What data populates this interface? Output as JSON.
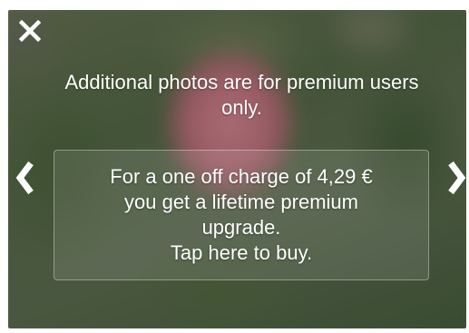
{
  "overlay": {
    "headline": "Additional photos are for premium users only.",
    "offer_lines": [
      "For a one off charge of 4,29 €",
      "you get a lifetime premium",
      "upgrade.",
      "Tap here to buy."
    ],
    "price": "4,29 €"
  },
  "controls": {
    "close_icon": "close-x-icon",
    "prev_icon": "chevron-left-icon",
    "next_icon": "chevron-right-icon"
  },
  "colors": {
    "text": "#ffffff",
    "accent_photo": "#b06a74"
  }
}
